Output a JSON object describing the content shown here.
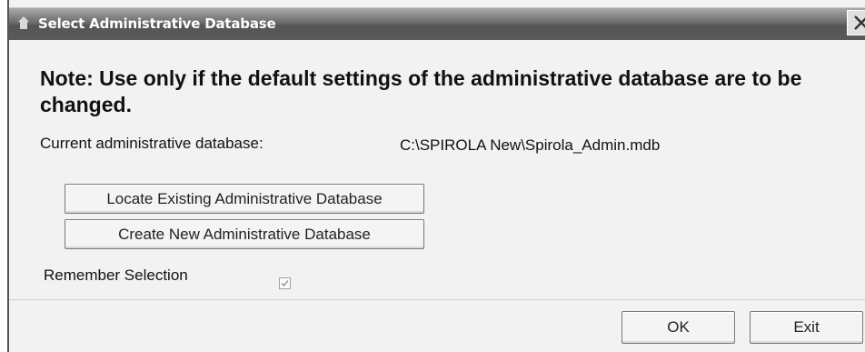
{
  "window": {
    "title": "Select Administrative Database",
    "close_glyph": "✕"
  },
  "content": {
    "note": "Note: Use only if the default settings of the administrative database are to be changed.",
    "current_label": "Current administrative database:",
    "current_value": "C:\\SPIROLA  New\\Spirola_Admin.mdb"
  },
  "buttons": {
    "locate": "Locate Existing Administrative Database",
    "create": "Create New Administrative Database",
    "ok": "OK",
    "exit": "Exit"
  },
  "remember": {
    "label": "Remember Selection",
    "checked": true
  },
  "icons": {
    "title_icon": "app-icon",
    "check_glyph": "✓"
  }
}
